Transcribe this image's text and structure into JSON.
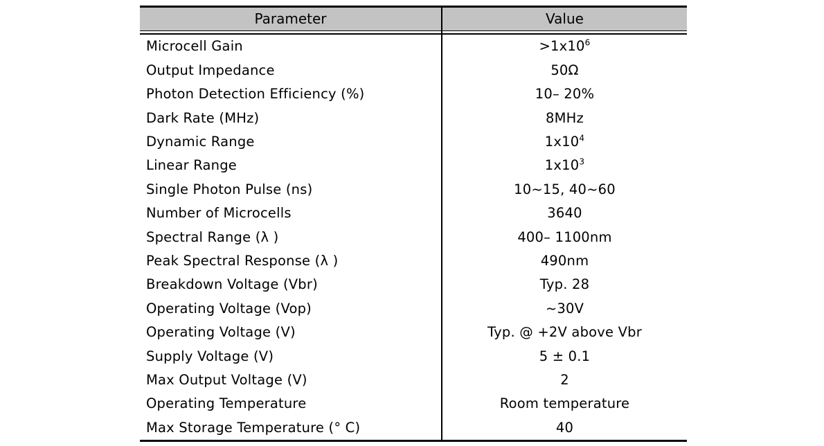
{
  "table": {
    "columns": [
      {
        "key": "parameter",
        "label": "Parameter"
      },
      {
        "key": "value",
        "label": "Value"
      }
    ],
    "header_background": "#c3c3c3",
    "rows": [
      {
        "parameter": "Microcell  Gain",
        "value": "&gt;1x10",
        "value_sup": "6"
      },
      {
        "parameter": "Output  Impedance",
        "value": "50Ω",
        "value_sup": ""
      },
      {
        "parameter": "Photon  Detection Efficiency (%)",
        "value": "10– 20%",
        "value_sup": ""
      },
      {
        "parameter": "Dark  Rate (MHz)",
        "value": "8MHz",
        "value_sup": ""
      },
      {
        "parameter": "Dynamic  Range",
        "value": "1x10",
        "value_sup": "4"
      },
      {
        "parameter": "Linear  Range",
        "value": "1x10",
        "value_sup": "3"
      },
      {
        "parameter": "Single  Photon Pulse (ns)",
        "value": "10~15, 40~60",
        "value_sup": ""
      },
      {
        "parameter": "Number  of Microcells",
        "value": "3640",
        "value_sup": ""
      },
      {
        "parameter": "Spectral  Range (λ )",
        "value": "400– 1100nm",
        "value_sup": ""
      },
      {
        "parameter": "Peak  Spectral Response (λ )",
        "value": "490nm",
        "value_sup": ""
      },
      {
        "parameter": "Breakdown  Voltage (Vbr)",
        "value": "Typ. 28",
        "value_sup": ""
      },
      {
        "parameter": "Operating  Voltage (Vop)",
        "value": "~30V",
        "value_sup": ""
      },
      {
        "parameter": "Operating  Voltage (V)",
        "value": "Typ. @ +2V above Vbr",
        "value_sup": ""
      },
      {
        "parameter": "Supply  Voltage (V)",
        "value": "5 ± 0.1",
        "value_sup": ""
      },
      {
        "parameter": "Max  Output Voltage (V)",
        "value": "2",
        "value_sup": ""
      },
      {
        "parameter": "Operating  Temperature",
        "value": "Room temperature",
        "value_sup": ""
      },
      {
        "parameter": "Max  Storage Temperature (° C)",
        "value": "40",
        "value_sup": ""
      }
    ]
  }
}
